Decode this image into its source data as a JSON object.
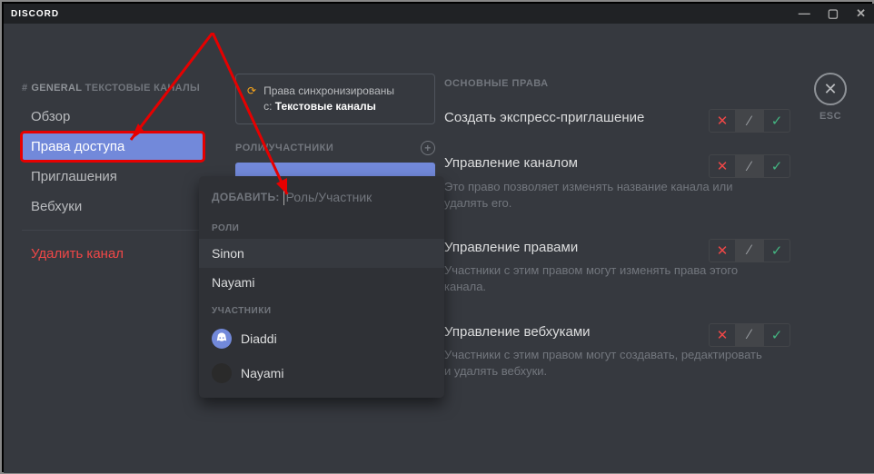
{
  "app_title": "DISCORD",
  "breadcrumb": {
    "prefix": "#",
    "channel": "GENERAL",
    "section": "ТЕКСТОВЫЕ КАНАЛЫ"
  },
  "nav": {
    "overview": "Обзор",
    "permissions": "Права доступа",
    "invites": "Приглашения",
    "webhooks": "Вебхуки",
    "delete": "Удалить канал"
  },
  "sync": {
    "line1": "Права синхронизированы",
    "line2_prefix": "с:",
    "line2_bold": "Текстовые каналы"
  },
  "roles_header": "РОЛИ/УЧАСТНИКИ",
  "popup": {
    "add_label": "ДОБАВИТЬ:",
    "placeholder": "Роль/Участник",
    "roles_label": "РОЛИ",
    "members_label": "УЧАСТНИКИ",
    "roles": [
      "Sinon",
      "Nayami"
    ],
    "members": [
      "Diaddi",
      "Nayami"
    ]
  },
  "perms_title": "ОСНОВНЫЕ ПРАВА",
  "perms": [
    {
      "title": "Создать экспресс-приглашение",
      "desc": ""
    },
    {
      "title": "Управление каналом",
      "desc": "Это право позволяет изменять название канала или удалять его."
    },
    {
      "title": "Управление правами",
      "desc": "Участники с этим правом могут изменять права этого канала."
    },
    {
      "title": "Управление вебхуками",
      "desc": "Участники с этим правом могут создавать, редактировать и удалять вебхуки."
    }
  ],
  "close_label": "ESC"
}
